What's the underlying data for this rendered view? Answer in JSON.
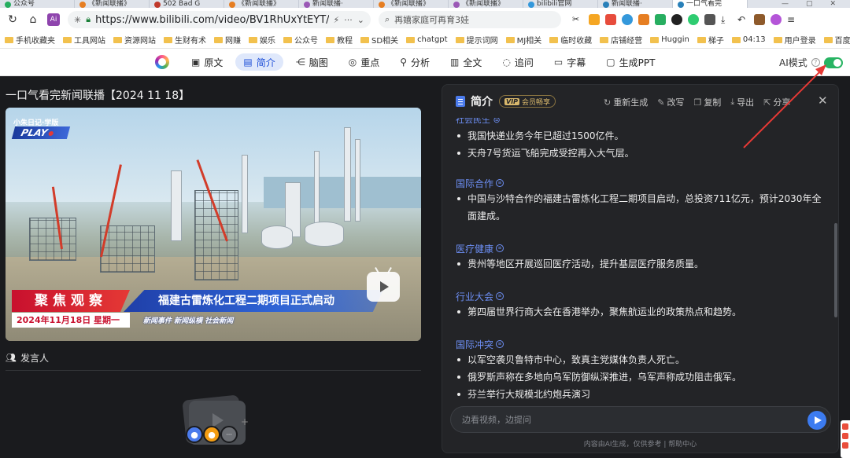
{
  "browser": {
    "tabs": [
      {
        "label": "公众号",
        "color": "#27ae60"
      },
      {
        "label": "《新闻联播》",
        "color": "#e67e22"
      },
      {
        "label": "502 Bad G",
        "color": "#c0392b"
      },
      {
        "label": "《新闻联播》",
        "color": "#e67e22"
      },
      {
        "label": "新闻联播·",
        "color": "#9b59b6"
      },
      {
        "label": "《新闻联播》",
        "color": "#e67e22"
      },
      {
        "label": "《新闻联播》",
        "color": "#9b59b6"
      },
      {
        "label": "bilibili官网",
        "color": "#3498db"
      },
      {
        "label": "新闻联播·",
        "color": "#2980b9"
      },
      {
        "label": "一口气看完",
        "color": "#2980b9"
      }
    ],
    "url": "https://www.bilibili.com/video/BV1RhUxYtEYT/?spm_id_",
    "search_text": "再嬉家庭可再育3娃",
    "bookmarks": [
      "手机收藏夹",
      "工具网站",
      "资源网站",
      "生财有术",
      "网赚",
      "娱乐",
      "公众号",
      "教程",
      "SD相关",
      "chatgpt",
      "提示词网",
      "MJ相关",
      "临时收藏",
      "店铺经营",
      "Huggin",
      "梯子",
      "04:13",
      "用户登录",
      "百度翻"
    ]
  },
  "ai_toolbar": {
    "tools": [
      {
        "label": "原文",
        "icon": "book-icon",
        "glyph": "▣"
      },
      {
        "label": "简介",
        "icon": "summary-icon",
        "glyph": "▤",
        "active": true
      },
      {
        "label": "脑图",
        "icon": "mindmap-icon",
        "glyph": "⋲"
      },
      {
        "label": "重点",
        "icon": "target-icon",
        "glyph": "◎"
      },
      {
        "label": "分析",
        "icon": "pin-icon",
        "glyph": "⚲"
      },
      {
        "label": "全文",
        "icon": "document-icon",
        "glyph": "▥"
      },
      {
        "label": "追问",
        "icon": "chat-icon",
        "glyph": "◌"
      },
      {
        "label": "字幕",
        "icon": "subtitle-icon",
        "glyph": "▭"
      },
      {
        "label": "生成PPT",
        "icon": "ppt-icon",
        "glyph": "▢"
      }
    ],
    "ai_mode_label": "AI模式",
    "ai_mode_on": true
  },
  "video": {
    "title": "一口气看完新闻联播【2024 11 18】",
    "overlay": {
      "corner_text": "小朱日记·学版",
      "play_mark": "PLAY",
      "banner_left": "聚焦观察",
      "banner_headline": "福建古雷炼化工程二期项目正式启动",
      "banner_date": "2024年11月18日 星期一",
      "banner_tags": "新闻事件  新闻纵横  社会新闻"
    }
  },
  "speakers": {
    "header": "发言人"
  },
  "summary_panel": {
    "title": "简介",
    "vip_label": "会员畅享",
    "actions": [
      {
        "label": "重新生成",
        "icon": "refresh-icon",
        "glyph": "↻"
      },
      {
        "label": "改写",
        "icon": "rewrite-icon",
        "glyph": "✎"
      },
      {
        "label": "复制",
        "icon": "copy-icon",
        "glyph": "❐"
      },
      {
        "label": "导出",
        "icon": "download-icon",
        "glyph": "⤓"
      },
      {
        "label": "分享",
        "icon": "share-icon",
        "glyph": "⇱"
      }
    ],
    "sections": [
      {
        "title": "",
        "items": [
          "我国快递业务今年已超过1500亿件。",
          "天舟7号货运飞船完成受控再入大气层。"
        ]
      },
      {
        "title": "国际合作",
        "items": [
          "中国与沙特合作的福建古雷炼化工程二期项目启动，总投资711亿元，预计2030年全面建成。"
        ]
      },
      {
        "title": "医疗健康",
        "items": [
          "贵州等地区开展巡回医疗活动，提升基层医疗服务质量。"
        ]
      },
      {
        "title": "行业大会",
        "items": [
          "第四届世界行商大会在香港举办，聚焦航运业的政策热点和趋势。"
        ]
      },
      {
        "title": "国际冲突",
        "items": [
          "以军空袭贝鲁特市中心，致真主党媒体负责人死亡。",
          "俄罗斯声称在多地向乌军防御纵深推进，乌军声称成功阻击俄军。",
          "芬兰举行大规模北约炮兵演习"
        ]
      }
    ],
    "chat_placeholder": "边看视频，边提问",
    "footnote": "内容由AI生成，仅供参考  |  帮助中心"
  }
}
